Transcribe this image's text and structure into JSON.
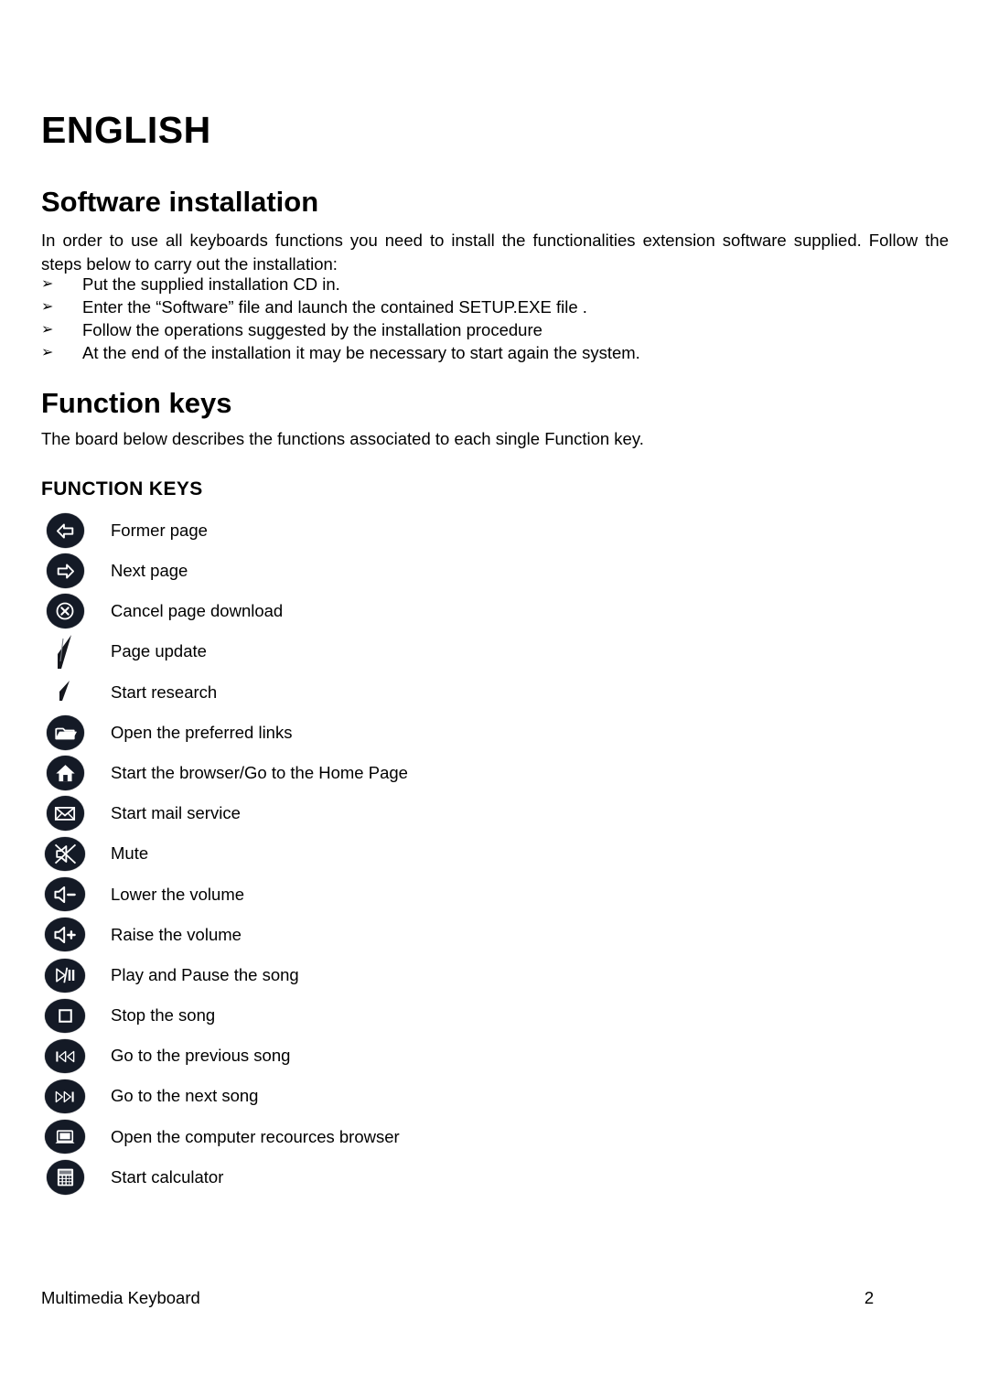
{
  "document": {
    "language_title": "ENGLISH",
    "sections": {
      "software": {
        "heading": "Software installation",
        "intro": "In order to use all keyboards functions you need to install the functionalities extension software supplied. Follow the steps below to carry out the installation:",
        "bullet_marker": "➢",
        "steps": [
          "Put the supplied installation CD in.",
          "Enter the “Software” file and launch the contained SETUP.EXE file .",
          "Follow the operations suggested by the installation procedure",
          "At the end of the installation it may be necessary to start again the system."
        ]
      },
      "function_keys": {
        "heading": "Function keys",
        "intro": "The board below describes the functions associated to each single Function key.",
        "table_title": "FUNCTION KEYS",
        "rows": [
          {
            "icon": "arrow-left-icon",
            "label": "Former page"
          },
          {
            "icon": "arrow-right-icon",
            "label": "Next page"
          },
          {
            "icon": "cancel-x-icon",
            "label": "Cancel page download"
          },
          {
            "icon": "refresh-wedge-icon",
            "label": "Page update"
          },
          {
            "icon": "search-wedge-icon",
            "label": "Start research"
          },
          {
            "icon": "folder-icon",
            "label": "Open the preferred links"
          },
          {
            "icon": "home-icon",
            "label": "Start the browser/Go to the Home Page"
          },
          {
            "icon": "mail-icon",
            "label": "Start mail service"
          },
          {
            "icon": "speaker-mute-icon",
            "label": "Mute"
          },
          {
            "icon": "volume-down-icon",
            "label": "Lower the volume"
          },
          {
            "icon": "volume-up-icon",
            "label": "Raise the volume"
          },
          {
            "icon": "play-pause-icon",
            "label": "Play and Pause the song"
          },
          {
            "icon": "stop-icon",
            "label": "Stop the song"
          },
          {
            "icon": "previous-track-icon",
            "label": "Go to the previous song"
          },
          {
            "icon": "next-track-icon",
            "label": "Go to the next song"
          },
          {
            "icon": "computer-icon",
            "label": "Open the computer recources browser"
          },
          {
            "icon": "calculator-icon",
            "label": "Start calculator"
          }
        ]
      }
    },
    "footer": {
      "left": "Multimedia Keyboard",
      "page_number": "2"
    },
    "colors": {
      "badge": "#141a26",
      "glyph": "#ffffff",
      "text": "#000000",
      "background": "#ffffff"
    }
  }
}
